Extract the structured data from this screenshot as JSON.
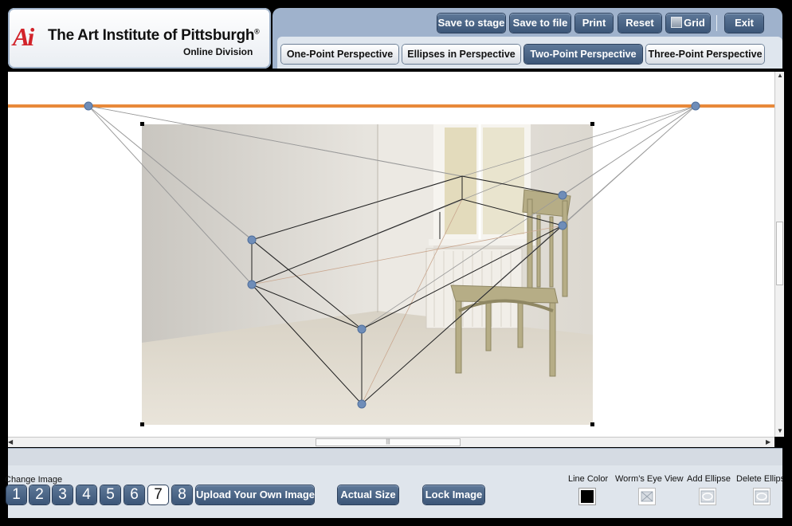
{
  "logo": {
    "mark": "Ai",
    "title": "The Art Institute of Pittsburgh",
    "registered": "®",
    "subtitle": "Online Division"
  },
  "toolbar": {
    "save_stage": "Save to stage",
    "save_file": "Save to file",
    "print": "Print",
    "reset": "Reset",
    "grid": "Grid",
    "exit": "Exit"
  },
  "tabs": [
    {
      "label": "One-Point Perspective"
    },
    {
      "label": "Ellipses in Perspective"
    },
    {
      "label": "Two-Point Perspective"
    },
    {
      "label": "Three-Point Perspective"
    }
  ],
  "active_tab": "Two-Point Perspective",
  "bottom": {
    "change_image_label": "Change Image",
    "image_numbers": [
      "1",
      "2",
      "3",
      "4",
      "5",
      "6",
      "7",
      "8"
    ],
    "selected_image": "7",
    "upload": "Upload Your Own Image",
    "actual_size": "Actual Size",
    "lock_image": "Lock Image",
    "line_color_label": "Line Color",
    "worms_eye_label": "Worm’s Eye View",
    "add_ellipse_label": "Add Ellipse",
    "delete_ellipse_label": "Delete Ellipse"
  },
  "colors": {
    "horizon": "#e8893a",
    "handle": "#6f8db8",
    "button": "#4a6484",
    "line_color": "#000000"
  }
}
